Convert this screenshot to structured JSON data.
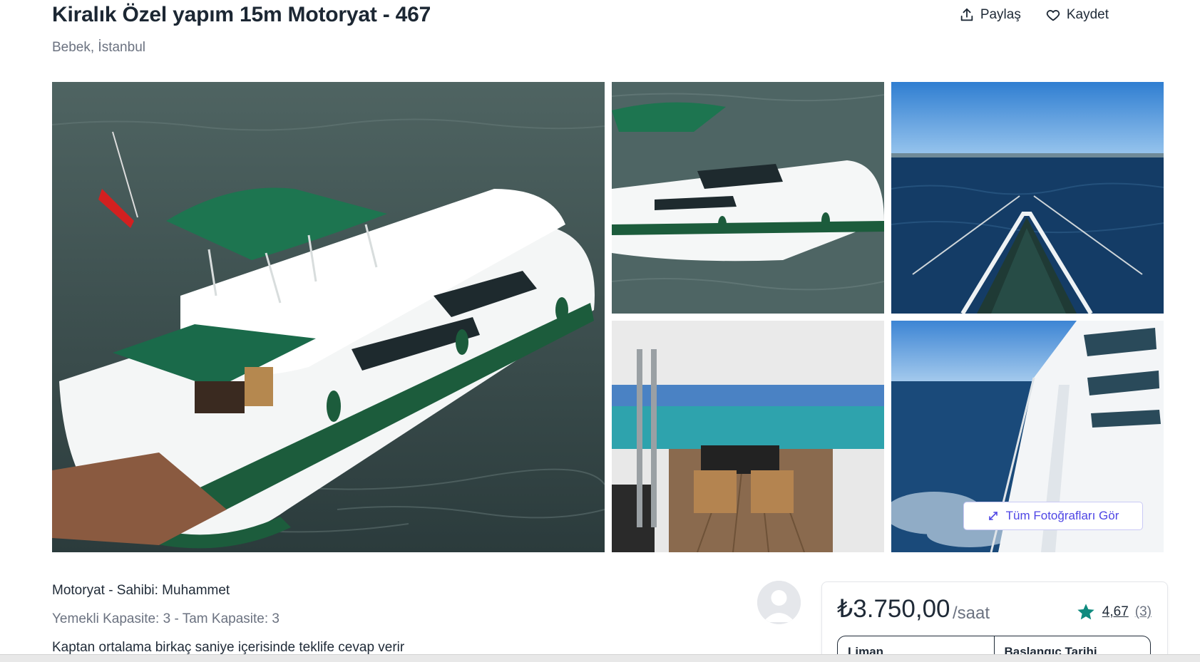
{
  "listing": {
    "title": "Kiralık Özel yapım 15m Motoryat - 467",
    "location": "Bebek, İstanbul"
  },
  "actions": {
    "share_label": "Paylaş",
    "save_label": "Kaydet"
  },
  "gallery": {
    "all_photos_label": "Tüm Fotoğrafları Gör"
  },
  "details": {
    "type_owner": "Motoryat - Sahibi: Muhammet",
    "capacity": "Yemekli Kapasite: 3 - Tam Kapasite: 3",
    "captain_response": "Kaptan ortalama birkaç saniye içerisinde teklife cevap verir"
  },
  "booking": {
    "price": "₺3.750,00",
    "price_unit": "/saat",
    "rating": "4,67",
    "rating_count": "(3)",
    "field_port_label": "Liman",
    "field_start_label": "Başlangıç Tarihi"
  },
  "colors": {
    "accent": "#4f46e5",
    "star": "#0f8a7e",
    "hull_green": "#1c5c3c"
  }
}
